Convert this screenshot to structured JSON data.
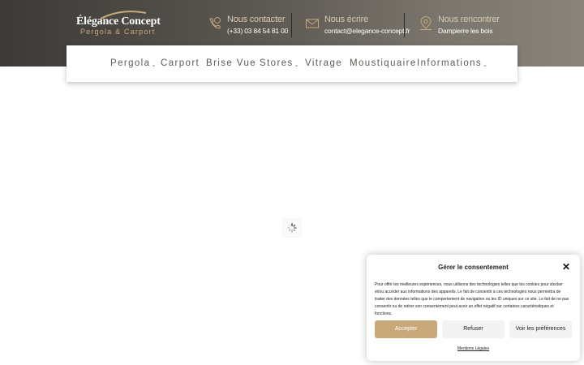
{
  "header": {
    "logo": {
      "title": "Élégance Concept",
      "subtitle": "Pergola & Carport"
    },
    "contacts": [
      {
        "label": "Nous contacter",
        "value": "(+33) 03 84 54 81 00",
        "icon": "phone-icon"
      },
      {
        "label": "Nous écrire",
        "value": "contact@elegance-concept.fr",
        "icon": "mail-icon"
      },
      {
        "label": "Nous rencontrer",
        "value": "Dampierre les bois",
        "icon": "location-pin-icon"
      }
    ]
  },
  "nav": {
    "items": [
      {
        "label": "Pergola",
        "has_dropdown": true
      },
      {
        "label": "Carport",
        "has_dropdown": false
      },
      {
        "label": "Brise Vue",
        "has_dropdown": false
      },
      {
        "label": "Stores",
        "has_dropdown": true
      },
      {
        "label": "Vitrage",
        "has_dropdown": false
      },
      {
        "label": "Moustiquaire",
        "has_dropdown": false
      },
      {
        "label": "Informations",
        "has_dropdown": true
      }
    ],
    "caret": "⌄"
  },
  "consent": {
    "title": "Gérer le consentement",
    "close_symbol": "✕",
    "text": "Pour offrir les meilleures expériences, nous utilisons des technologies telles que les cookies pour stocker et/ou accéder aux informations des appareils. Le fait de consentir à ces technologies nous permettra de traiter des données telles que le comportement de navigation ou les ID uniques sur ce site. Le fait de ne pas consentir ou de retirer son consentement peut avoir un effet négatif sur certaines caractéristiques et fonctions.",
    "accept_label": "Accepter",
    "refuse_label": "Refuser",
    "prefs_label": "Voir les préférences",
    "legal_link": "Mentions Légales"
  },
  "colors": {
    "accent": "#c9a97a",
    "nav_text": "#5e5a54",
    "header_dark": "#3c3a37"
  }
}
